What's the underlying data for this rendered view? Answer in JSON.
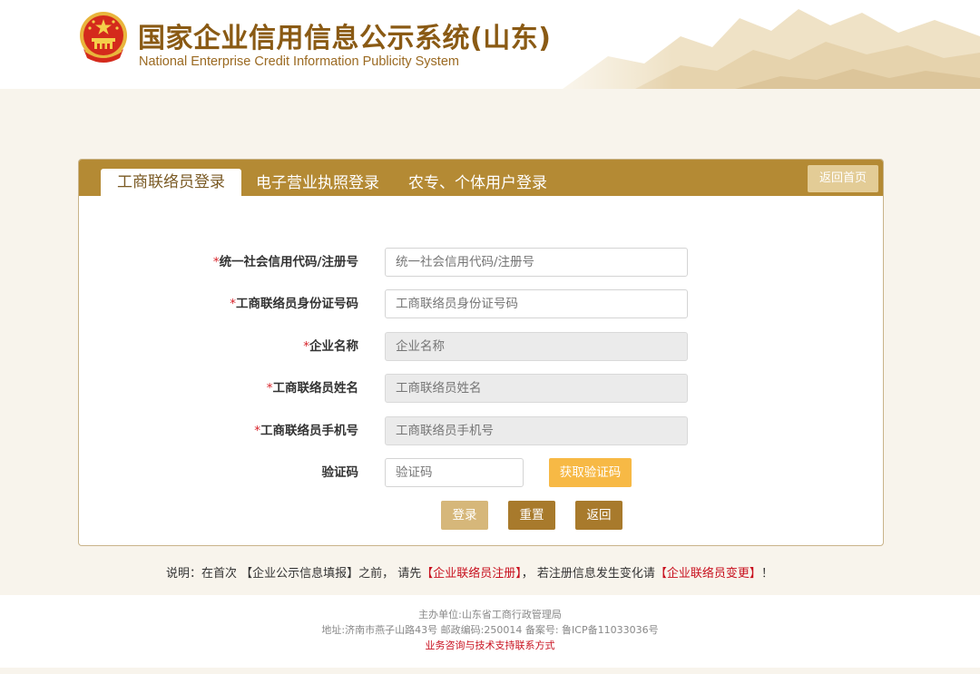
{
  "header": {
    "title_cn": "国家企业信用信息公示系统(山东)",
    "title_en": "National Enterprise Credit Information Publicity System",
    "emblem_icon": "national-emblem-icon"
  },
  "tabs": [
    {
      "label": "工商联络员登录",
      "active": true
    },
    {
      "label": "电子营业执照登录",
      "active": false
    },
    {
      "label": "农专、个体用户登录",
      "active": false
    }
  ],
  "home_button": "返回首页",
  "form": {
    "credit_code": {
      "label": "统一社会信用代码/注册号",
      "placeholder": "统一社会信用代码/注册号",
      "required": "*"
    },
    "id_number": {
      "label": "工商联络员身份证号码",
      "placeholder": "工商联络员身份证号码",
      "required": "*"
    },
    "company_name": {
      "label": "企业名称",
      "placeholder": "企业名称",
      "required": "*"
    },
    "contact_name": {
      "label": "工商联络员姓名",
      "placeholder": "工商联络员姓名",
      "required": "*"
    },
    "contact_phone": {
      "label": "工商联络员手机号",
      "placeholder": "工商联络员手机号",
      "required": "*"
    },
    "captcha": {
      "label": "验证码",
      "placeholder": "验证码"
    },
    "get_code_button": "获取验证码"
  },
  "actions": {
    "login": "登录",
    "reset": "重置",
    "back": "返回"
  },
  "note": {
    "prefix": "说明：在首次 【企业公示信息填报】之前， 请先",
    "link1": "【企业联络员注册】",
    "middle": "， 若注册信息发生变化请",
    "link2": "【企业联络员变更】",
    "suffix": "！"
  },
  "footer": {
    "line1": "主办单位:山东省工商行政管理局",
    "line2": "地址:济南市燕子山路43号    邮政编码:250014    备案号: 鲁ICP备11033036号",
    "line3": "业务咨询与技术支持联系方式"
  },
  "colors": {
    "brand": "#b48a34",
    "title": "#8a5a14",
    "required": "#d7232a",
    "highlight_button": "#f7b945"
  }
}
